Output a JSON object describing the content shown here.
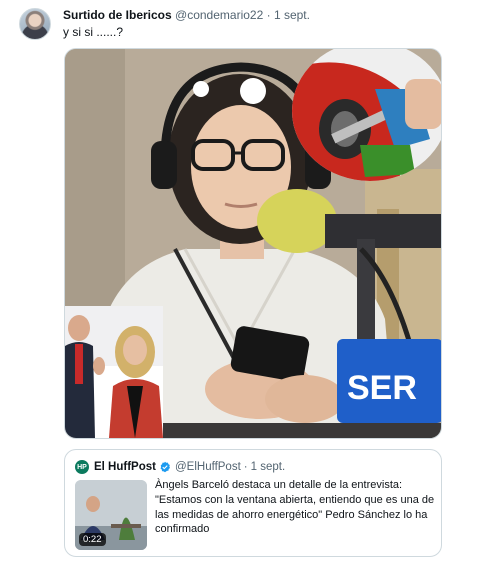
{
  "tweet": {
    "author_name": "Surtido de Ibericos",
    "author_handle": "@condemario22",
    "separator": "·",
    "date": "1 sept.",
    "text": "y si si ......?"
  },
  "media": {
    "sign_text": "SER"
  },
  "quote": {
    "logo_text": "HP",
    "author_name": "El HuffPost",
    "author_handle": "@ElHuffPost",
    "separator": "·",
    "date": "1 sept.",
    "video_duration": "0:22",
    "text": "Àngels Barceló destaca un detalle de la entrevista: \"Estamos con la ventana abierta, entiendo que es una de las medidas de ahorro energético\" Pedro Sánchez lo ha confirmado"
  },
  "colors": {
    "verified": "#1d9bf0",
    "ser_sign": "#1f5fc9",
    "gas_car": "#c8281e",
    "gas_nozzle": "#3a8f2a"
  }
}
